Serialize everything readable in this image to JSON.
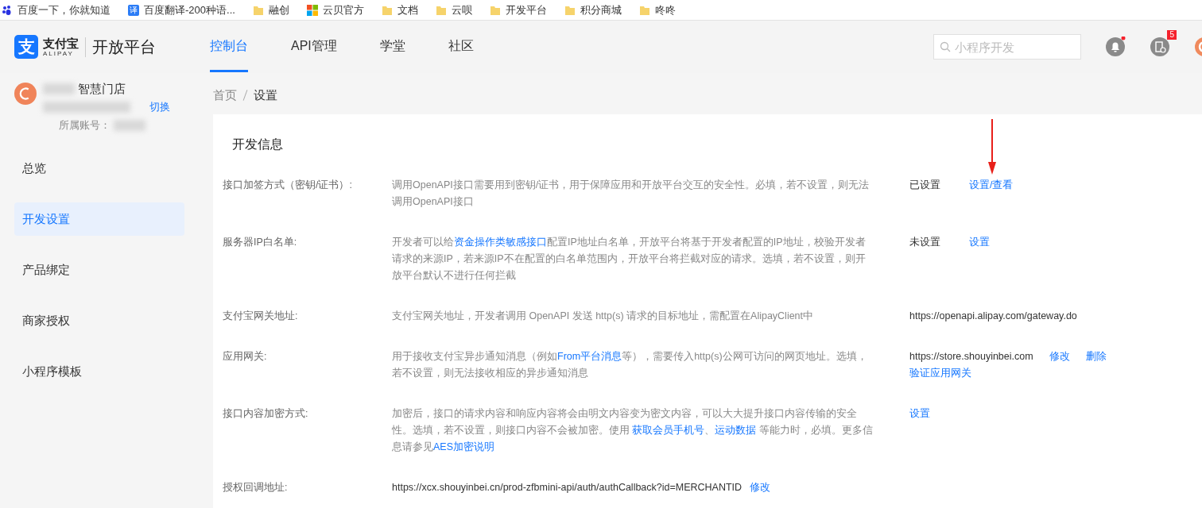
{
  "bookmarks": [
    {
      "kind": "baidu",
      "label": "百度一下，你就知道"
    },
    {
      "kind": "translate",
      "label": "百度翻译-200种语...",
      "glyph": "译"
    },
    {
      "kind": "folder",
      "label": "融创"
    },
    {
      "kind": "tiles",
      "label": "云贝官方"
    },
    {
      "kind": "folder",
      "label": "文档"
    },
    {
      "kind": "folder",
      "label": "云呗"
    },
    {
      "kind": "folder",
      "label": "开发平台"
    },
    {
      "kind": "folder",
      "label": "积分商城"
    },
    {
      "kind": "folder",
      "label": "咚咚"
    }
  ],
  "header": {
    "logo": {
      "glyph": "支",
      "brand": "支付宝",
      "brand_latin": "ALIPAY",
      "product": "开放平台"
    },
    "nav": [
      {
        "label": "控制台",
        "selected": true
      },
      {
        "label": "API管理",
        "selected": false
      },
      {
        "label": "学堂",
        "selected": false
      },
      {
        "label": "社区",
        "selected": false
      }
    ],
    "search": {
      "placeholder": "小程序开发"
    },
    "notifications": {
      "unread": true
    },
    "messages": {
      "badge": "5"
    }
  },
  "sidebar": {
    "store": {
      "name": "智慧门店",
      "switch": "切换",
      "account_label": "所属账号："
    },
    "items": [
      {
        "label": "总览",
        "selected": false
      },
      {
        "label": "开发设置",
        "selected": true
      },
      {
        "label": "产品绑定",
        "selected": false
      },
      {
        "label": "商家授权",
        "selected": false
      },
      {
        "label": "小程序模板",
        "selected": false
      }
    ]
  },
  "breadcrumb": [
    {
      "label": "首页",
      "current": false
    },
    {
      "label": "设置",
      "current": true
    }
  ],
  "section": {
    "title": "开发信息",
    "rows": [
      {
        "label": "接口加签方式（密钥/证书）:",
        "description": [
          {
            "kind": "text",
            "text": "调用OpenAPI接口需要用到密钥/证书，用于保障应用和开放平台交互的安全性。必填，若不设置，则无法调用OpenAPI接口"
          }
        ],
        "lines": [
          [
            {
              "kind": "status",
              "text": "已设置"
            },
            {
              "kind": "link",
              "text": "设置/查看",
              "annotated": true
            }
          ]
        ]
      },
      {
        "label": "服务器IP白名单:",
        "description": [
          {
            "kind": "text",
            "text": "开发者可以给"
          },
          {
            "kind": "link",
            "text": "资金操作类敏感接口"
          },
          {
            "kind": "text",
            "text": "配置IP地址白名单，开放平台将基于开发者配置的IP地址，校验开发者请求的来源IP，若来源IP不在配置的白名单范围内，开放平台将拦截对应的请求。选填，若不设置，则开放平台默认不进行任何拦截"
          }
        ],
        "lines": [
          [
            {
              "kind": "status",
              "text": "未设置"
            },
            {
              "kind": "link",
              "text": "设置"
            }
          ]
        ]
      },
      {
        "label": "支付宝网关地址:",
        "description": [
          {
            "kind": "text",
            "text": "支付宝网关地址，开发者调用 OpenAPI 发送 http(s) 请求的目标地址，需配置在AlipayClient中"
          }
        ],
        "lines": [
          [
            {
              "kind": "value",
              "text": "https://openapi.alipay.com/gateway.do"
            }
          ]
        ]
      },
      {
        "label": "应用网关:",
        "description": [
          {
            "kind": "text",
            "text": "用于接收支付宝异步通知消息（例如"
          },
          {
            "kind": "link",
            "text": "From平台消息"
          },
          {
            "kind": "text",
            "text": "等），需要传入http(s)公网可访问的网页地址。选填，若不设置，则无法接收相应的异步通知消息"
          }
        ],
        "lines": [
          [
            {
              "kind": "value",
              "text": "https://store.shouyinbei.com"
            },
            {
              "kind": "link",
              "text": "修改"
            },
            {
              "kind": "link",
              "text": "删除"
            }
          ],
          [
            {
              "kind": "link",
              "text": "验证应用网关"
            }
          ]
        ]
      },
      {
        "label": "接口内容加密方式:",
        "description": [
          {
            "kind": "text",
            "text": "加密后，接口的请求内容和响应内容将会由明文内容变为密文内容，可以大大提升接口内容传输的安全性。选填，若不设置，则接口内容不会被加密。使用 "
          },
          {
            "kind": "link",
            "text": "获取会员手机号"
          },
          {
            "kind": "text",
            "text": "、"
          },
          {
            "kind": "link",
            "text": "运动数据"
          },
          {
            "kind": "text",
            "text": " 等能力时，必填。更多信息请参见"
          },
          {
            "kind": "link",
            "text": "AES加密说明"
          }
        ],
        "lines": [
          [
            {
              "kind": "link",
              "text": "设置"
            }
          ]
        ]
      },
      {
        "label": "授权回调地址:",
        "description": [
          {
            "kind": "value",
            "text": "https://xcx.shouyinbei.cn/prod-zfbmini-api/auth/authCallback?id=MERCHANTID"
          },
          {
            "kind": "link",
            "text": "修改"
          }
        ],
        "lines": []
      }
    ]
  }
}
